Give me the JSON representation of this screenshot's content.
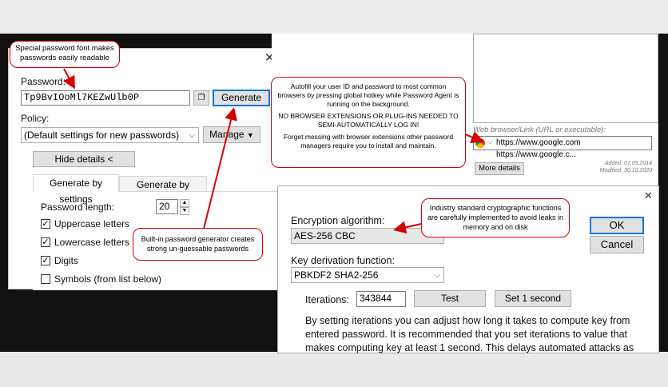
{
  "left_dialog": {
    "password_label": "Password:",
    "password_value": "Tp9BvIOoMl7KEZwUlb0P",
    "generate_label": "Generate",
    "policy_label": "Policy:",
    "policy_value": "(Default settings for new passwords)",
    "manage_label": "Manage",
    "hide_details_label": "Hide details <",
    "tabs": [
      "Generate by settings",
      "Generate by template"
    ],
    "length_label": "Password length:",
    "length_value": "20",
    "checkboxes": [
      {
        "label": "Uppercase letters",
        "checked": true
      },
      {
        "label": "Lowercase letters",
        "checked": true
      },
      {
        "label": "Digits",
        "checked": true
      },
      {
        "label": "Symbols (from list below)",
        "checked": false
      }
    ]
  },
  "right_panel": {
    "web_label": "Web browser/Link (URL or executable):",
    "url_value": "https://www.google.com  https://www.google.c...",
    "more_details_label": "More details",
    "added": "Added: 07.05.2014",
    "modified": "Modified: 30.10.2020"
  },
  "crypto_dialog": {
    "encryption_label": "Encryption algorithm:",
    "encryption_value": "AES-256 CBC",
    "kdf_label": "Key derivation function:",
    "kdf_value": "PBKDF2 SHA2-256",
    "iterations_label": "Iterations:",
    "iterations_value": "343844",
    "test_label": "Test",
    "set_label": "Set 1 second",
    "ok_label": "OK",
    "cancel_label": "Cancel",
    "description": "By setting iterations you can adjust how long it takes to compute key from entered password. It is recommended that you set iterations to value that makes computing key at least 1 second. This delays automated attacks as"
  },
  "callouts": {
    "font": "Special password font makes passwords easily readable",
    "autofill_1": "Autofill your user ID and password to most common browsers by pressing global hotkey while Password Agent is running on the background.",
    "autofill_2": "NO BROWSER EXTENSIONS OR PLUG-INS NEEDED TO SEMI-AUTOMATICALLY LOG IN!",
    "autofill_3": "Forget messing with browser extensions other password managers require you to install and maintain.",
    "crypto": "Industry standard cryptographic functions are carefully implemented to avoid leaks in memory and on disk",
    "generator": "Built-in password generator creates strong un-guessable passwords"
  },
  "colors": {
    "accent": "#0078d7",
    "callout_border": "#d60000"
  }
}
